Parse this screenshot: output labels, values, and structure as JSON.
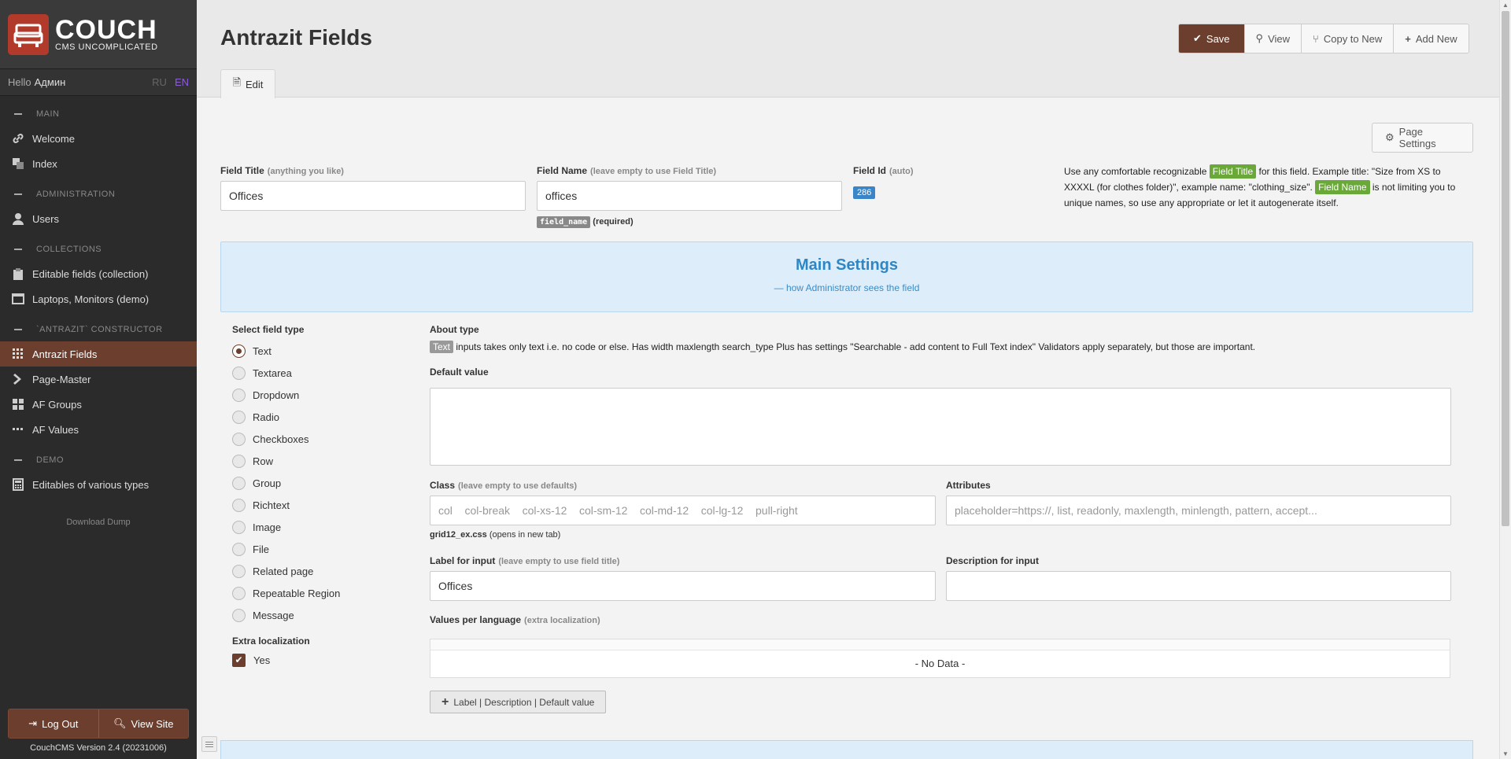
{
  "app": {
    "logo_title": "COUCH",
    "logo_sub": "CMS UNCOMPLICATED",
    "hello": "Hello",
    "user": "Админ",
    "lang_ru": "RU",
    "lang_en": "EN"
  },
  "sidebar": {
    "sec_main": "MAIN",
    "welcome": "Welcome",
    "index": "Index",
    "sec_admin": "ADMINISTRATION",
    "users": "Users",
    "sec_collections": "COLLECTIONS",
    "editable_fields": "Editable fields (collection)",
    "laptops": "Laptops, Monitors (demo)",
    "sec_constructor": "`ANTRAZIT` CONSTRUCTOR",
    "antrazit_fields": "Antrazit Fields",
    "page_master": "Page-Master",
    "af_groups": "AF Groups",
    "af_values": "AF Values",
    "sec_demo": "DEMO",
    "editables": "Editables of various types",
    "download": "Download Dump",
    "logout": "Log Out",
    "view_site": "View Site",
    "version": "CouchCMS Version 2.4 (20231006)"
  },
  "header": {
    "title": "Antrazit Fields",
    "save": "Save",
    "view": "View",
    "copy": "Copy to New",
    "add": "Add New",
    "tab_edit": "Edit"
  },
  "form": {
    "page_settings": "Page Settings",
    "field_title_label": "Field Title",
    "field_title_hint": "(anything you like)",
    "field_title_value": "Offices",
    "field_name_label": "Field Name",
    "field_name_hint": "(leave empty to use Field Title)",
    "field_name_value": "offices",
    "field_name_tag": "field_name",
    "required": "(required)",
    "field_id_label": "Field Id",
    "field_id_hint": "(auto)",
    "field_id_value": "286",
    "help_1": "Use any comfortable recognizable",
    "help_tag1": "Field Title",
    "help_2": "for this field. Example title: \"Size from XS to XXXXL (for clothes folder)\", example name: \"clothing_size\".",
    "help_tag2": "Field Name",
    "help_3": "is not limiting you to unique names, so use any appropriate or let it autogenerate itself.",
    "ms_title": "Main Settings",
    "ms_sub": "— how Administrator sees the field",
    "select_type": "Select field type",
    "types": [
      "Text",
      "Textarea",
      "Dropdown",
      "Radio",
      "Checkboxes",
      "Row",
      "Group",
      "Richtext",
      "Image",
      "File",
      "Related page",
      "Repeatable Region",
      "Message"
    ],
    "selected_type": "Text",
    "extra_loc": "Extra localization",
    "extra_yes": "Yes",
    "about_type": "About type",
    "about_tag": "Text",
    "about_text": "inputs takes only text i.e. no code or else. Has width maxlength search_type Plus has settings \"Searchable - add content to Full Text index\" Validators apply separately, but those are important.",
    "default_value": "Default value",
    "class_label": "Class",
    "class_hint": "(leave empty to use defaults)",
    "class_placeholder": "col    col-break    col-xs-12    col-sm-12    col-md-12    col-lg-12    pull-right",
    "grid_link": "grid12_ex.css",
    "grid_note": "(opens in new tab)",
    "attr_label": "Attributes",
    "attr_placeholder": "placeholder=https://, list, readonly, maxlength, minlength, pattern, accept...",
    "label_input": "Label for input",
    "label_input_hint": "(leave empty to use field title)",
    "label_input_value": "Offices",
    "desc_input": "Description for input",
    "vpl_label": "Values per language",
    "vpl_hint": "(extra localization)",
    "no_data": "- No Data -",
    "add_btn": "Label | Description | Default value"
  }
}
